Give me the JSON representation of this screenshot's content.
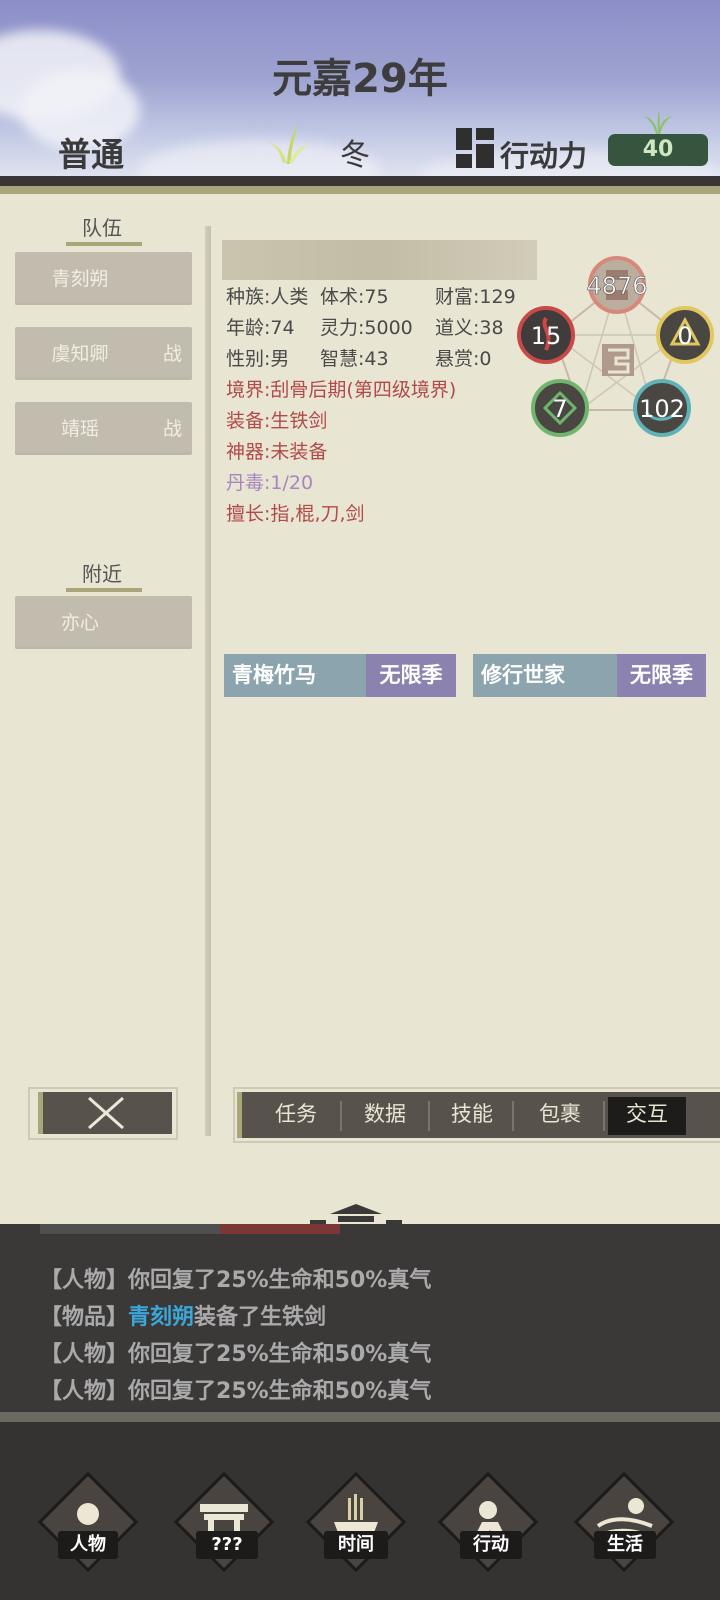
{
  "header": {
    "title": "元嘉29年",
    "mode": "普通",
    "season": "冬",
    "action_label": "行动力",
    "action_value": "40"
  },
  "sidebar": {
    "team_title": "队伍",
    "team": [
      {
        "name": "青刻朔",
        "tag": ""
      },
      {
        "name": "虞知卿",
        "tag": "战"
      },
      {
        "name": "靖瑶",
        "tag": "战"
      }
    ],
    "nearby_title": "附近",
    "nearby": [
      {
        "name": "亦心"
      }
    ]
  },
  "character": {
    "race": "种族:人类",
    "body": "体术:75",
    "wealth": "财富:129",
    "age": "年龄:74",
    "spirit": "灵力:5000",
    "righteous": "道义:38",
    "gender": "性别:男",
    "wisdom": "智慧:43",
    "bounty": "悬赏:0",
    "realm": "境界:刮骨后期(第四级境界)",
    "equip": "装备:生铁剑",
    "artifact": "神器:未装备",
    "poison": "丹毒:1/20",
    "skill": "擅长:指,棍,刀,剑"
  },
  "elements": {
    "top": "4876",
    "left": "15",
    "right": "0",
    "bottom_left": "7",
    "bottom_right": "102"
  },
  "traits": [
    {
      "name": "青梅竹马",
      "tag": "无限季"
    },
    {
      "name": "修行世家",
      "tag": "无限季"
    }
  ],
  "tabs": [
    "任务",
    "数据",
    "技能",
    "包裹",
    "交互"
  ],
  "log": {
    "line1_tag": "【人物】",
    "line1_text": "你回复了25%生命和50%真气",
    "line2_tag": "【物品】",
    "line2_name": "青刻朔",
    "line2_text": "装备了生铁剑",
    "line3_tag": "【人物】",
    "line3_text": "你回复了25%生命和50%真气",
    "line4_tag": "【人物】",
    "line4_text": "你回复了25%生命和50%真气"
  },
  "nav": [
    "人物",
    "???",
    "时间",
    "行动",
    "生活"
  ]
}
